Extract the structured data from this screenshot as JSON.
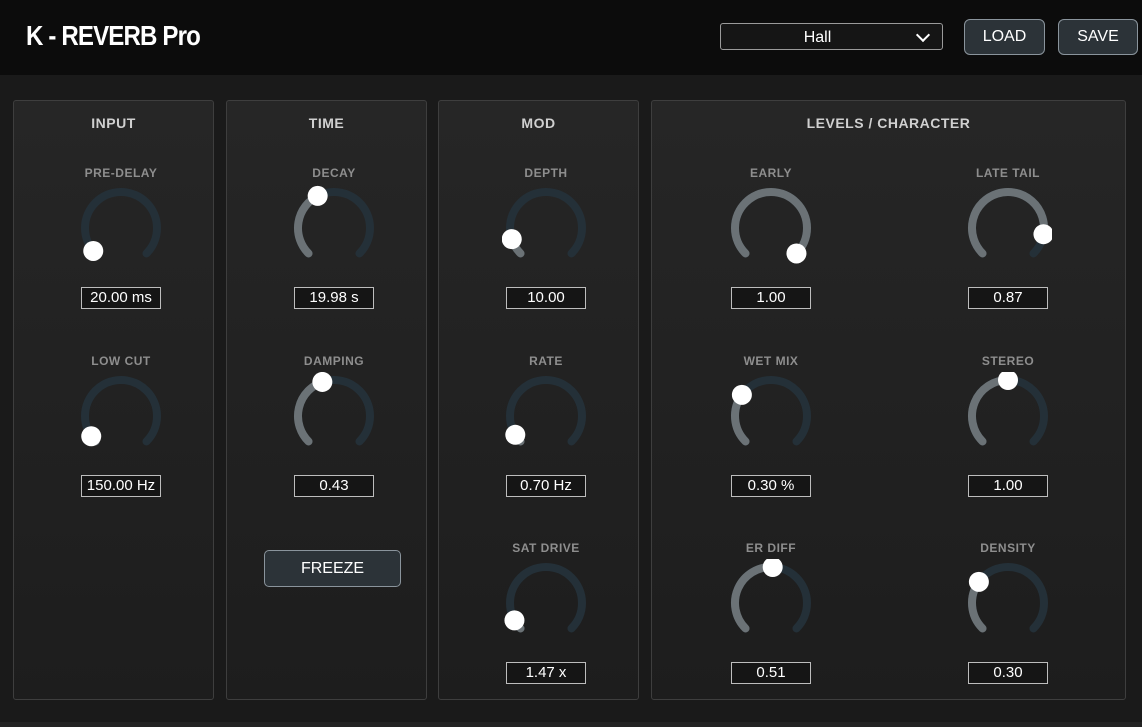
{
  "app": {
    "title": "K - REVERB Pro"
  },
  "header": {
    "preset": {
      "selected": "Hall",
      "icon": "chevron-down-icon"
    },
    "load_label": "LOAD",
    "save_label": "SAVE"
  },
  "colors": {
    "track": "#243038",
    "fill": "#6b7276",
    "handle": "#ffffff",
    "accent_button": "#2c3338"
  },
  "panels": {
    "input": {
      "title": "INPUT",
      "knobs": [
        {
          "label": "PRE-DELAY",
          "value": "20.00 ms",
          "level": 0.02
        },
        {
          "label": "LOW CUT",
          "value": "150.00 Hz",
          "level": 0.04
        }
      ]
    },
    "time": {
      "title": "TIME",
      "knobs": [
        {
          "label": "DECAY",
          "value": "19.98 s",
          "level": 0.4
        },
        {
          "label": "DAMPING",
          "value": "0.43",
          "level": 0.43
        }
      ],
      "freeze_label": "FREEZE"
    },
    "mod": {
      "title": "MOD",
      "knobs": [
        {
          "label": "DEPTH",
          "value": "10.00",
          "level": 0.1
        },
        {
          "label": "RATE",
          "value": "0.70 Hz",
          "level": 0.05
        },
        {
          "label": "SAT DRIVE",
          "value": "1.47 x",
          "level": 0.06
        }
      ]
    },
    "levels": {
      "title": "LEVELS / CHARACTER",
      "knobs": [
        {
          "label": "EARLY",
          "value": "1.00",
          "level": 1.0
        },
        {
          "label": "LATE TAIL",
          "value": "0.87",
          "level": 0.87
        },
        {
          "label": "WET MIX",
          "value": "0.30 %",
          "level": 0.3
        },
        {
          "label": "STEREO",
          "value": "1.00",
          "level": 0.5
        },
        {
          "label": "ER DIFF",
          "value": "0.51",
          "level": 0.51
        },
        {
          "label": "DENSITY",
          "value": "0.30",
          "level": 0.3
        }
      ]
    }
  }
}
